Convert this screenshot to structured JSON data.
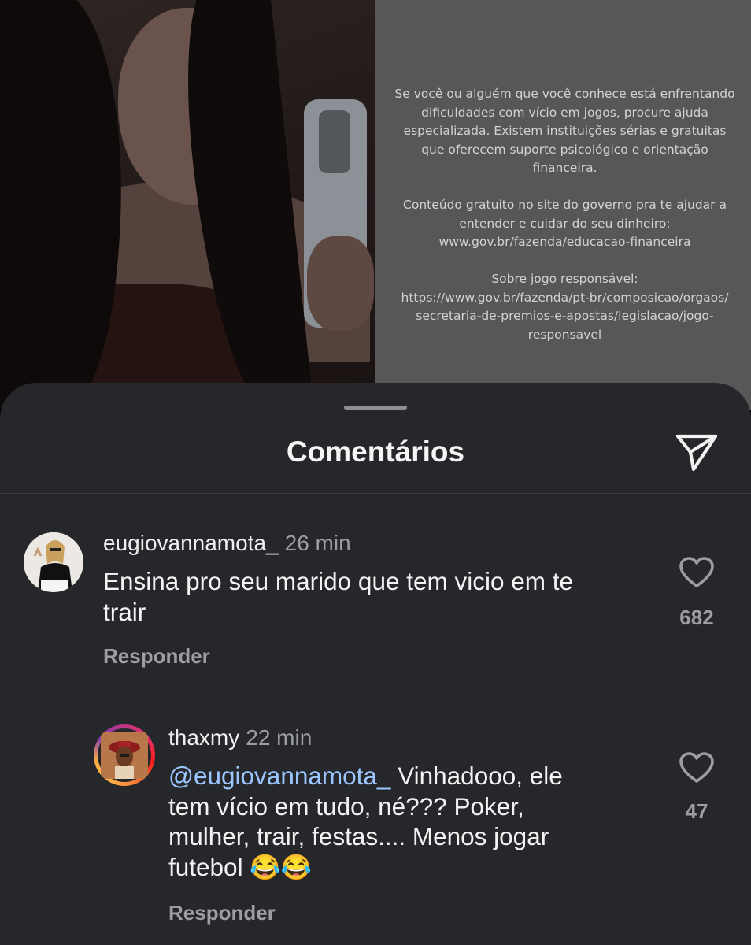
{
  "disclaimer": {
    "paragraph1": "Se você ou alguém que você conhece está enfrentando\ndificuldades com vício em jogos, procure ajuda\nespecializada. Existem instituições sérias e gratuitas\nque oferecem suporte psicológico e orientação\nfinanceira.",
    "paragraph2": "Conteúdo gratuito no site do governo pra te ajudar a\nentender e cuidar do seu dinheiro:\nwww.gov.br/fazenda/educacao-financeira",
    "paragraph3": "Sobre jogo responsável:\nhttps://www.gov.br/fazenda/pt-br/composicao/orgaos/\nsecretaria-de-premios-e-apostas/legislacao/jogo-\nresponsavel"
  },
  "sheet": {
    "title": "Comentários",
    "share_icon": "paper-plane-icon"
  },
  "comments": [
    {
      "username": "eugiovannamota_",
      "time": "26 min",
      "text": "Ensina pro seu marido que tem vicio em te\ntrair",
      "likes": "682",
      "reply_label": "Responder"
    },
    {
      "username": "thaxmy",
      "time": "22 min",
      "mention": "@eugiovannamota_",
      "text": " Vinhadooo, ele\ntem vício em tudo, né??? Poker,\nmulher, trair, festas.... Menos jogar\nfutebol 😂😂",
      "likes": "47",
      "reply_label": "Responder"
    }
  ],
  "colors": {
    "sheet_bg": "#25272b",
    "mention": "#9cc6ff",
    "muted_text": "#9c9ea3",
    "story_ring": "#e1306c"
  }
}
